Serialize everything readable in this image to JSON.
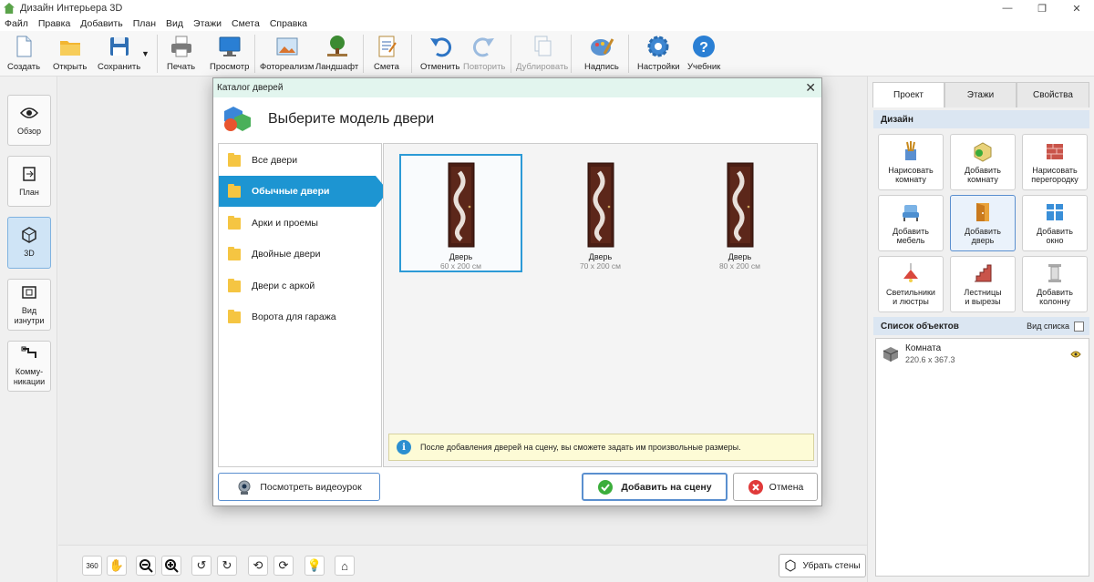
{
  "window": {
    "title": "Дизайн Интерьера 3D",
    "controls": [
      "—",
      "❐",
      "✕"
    ]
  },
  "menu": [
    "Файл",
    "Правка",
    "Добавить",
    "План",
    "Вид",
    "Этажи",
    "Смета",
    "Справка"
  ],
  "toolbar": {
    "create": "Создать",
    "open": "Открыть",
    "save": "Сохранить",
    "print": "Печать",
    "preview": "Просмотр",
    "photoreal": "Фотореализм",
    "landscape": "Ландшафт",
    "estimate": "Смета",
    "undo": "Отменить",
    "redo": "Повторить",
    "duplicate": "Дублировать",
    "captions": "Надпись",
    "settings": "Настройки",
    "tutorial": "Учебник"
  },
  "leftnav": {
    "overview": "Обзор",
    "plan": "План",
    "view3d": "3D",
    "inside": "Вид\nизнутри",
    "comms": "Комму-\nникации"
  },
  "dialog": {
    "title": "Каталог дверей",
    "heading": "Выберите модель двери",
    "categories": [
      "Все двери",
      "Обычные двери",
      "Арки и проемы",
      "Двойные двери",
      "Двери с аркой",
      "Ворота для гаража"
    ],
    "selected_category": "Обычные двери",
    "doors": [
      {
        "name": "Дверь",
        "size": "60 x 200 см"
      },
      {
        "name": "Дверь",
        "size": "70 x 200 см"
      },
      {
        "name": "Дверь",
        "size": "80 x 200 см"
      }
    ],
    "info": "После добавления дверей на сцену, вы сможете задать им произвольные размеры.",
    "video_button": "Посмотреть видеоурок",
    "add_button": "Добавить на сцену",
    "cancel_button": "Отмена"
  },
  "right": {
    "tabs": [
      "Проект",
      "Этажи",
      "Свойства"
    ],
    "design_title": "Дизайн",
    "buttons": [
      "Нарисовать\nкомнату",
      "Добавить\nкомнату",
      "Нарисовать\nперегородку",
      "Добавить\nмебель",
      "Добавить\nдверь",
      "Добавить\nокно",
      "Светильники\nи люстры",
      "Лестницы\nи вырезы",
      "Добавить\nколонну"
    ],
    "objects_title": "Список объектов",
    "view_list": "Вид списка",
    "objects": [
      {
        "name": "Комната",
        "dims": "220.6 x 367.3"
      }
    ]
  },
  "bottom": {
    "remove_walls": "Убрать стены",
    "view360": "360"
  }
}
